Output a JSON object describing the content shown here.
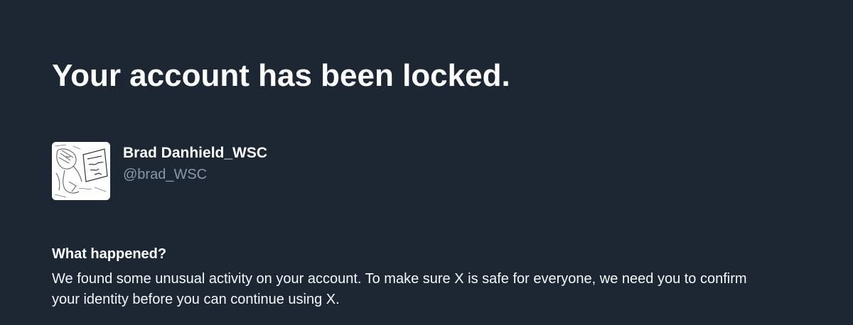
{
  "page": {
    "title": "Your account has been locked."
  },
  "account": {
    "display_name": "Brad Danhield_WSC",
    "handle": "@brad_WSC",
    "avatar_icon": "sketch-avatar-icon"
  },
  "section": {
    "heading": "What happened?",
    "body": "We found some unusual activity on your account. To make sure X is safe for everyone, we need you to confirm your identity before you can continue using X."
  },
  "colors": {
    "background": "#1c2733",
    "text": "#ffffff",
    "muted": "#8899a6"
  }
}
